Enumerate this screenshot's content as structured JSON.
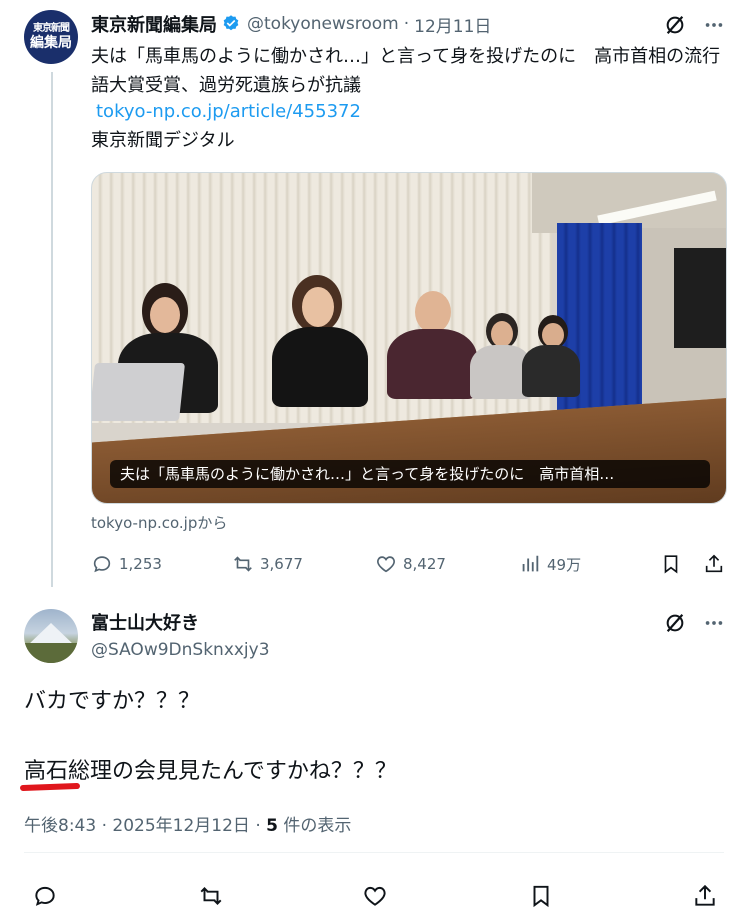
{
  "tweet1": {
    "avatar": {
      "top_text": "東京新聞",
      "bottom_text": "編集局"
    },
    "name": "東京新聞編集局",
    "handle": "@tokyonewsroom",
    "separator": "·",
    "date": "12月11日",
    "text": "夫は「馬車馬のように働かされ…」と言って身を投げたのに　高市首相の流行語大賞受賞、過労死遺族らが抗議",
    "link": "tokyo-np.co.jp/article/455372",
    "source_name": "東京新聞デジタル",
    "image_caption": "夫は「馬車馬のように働かされ…」と言って身を投げたのに　高市首相…",
    "from_site": "tokyo-np.co.jpから",
    "actions": {
      "replies": "1,253",
      "reposts": "3,677",
      "likes": "8,427",
      "views": "49万"
    },
    "icons": [
      "verified-badge-icon",
      "grok-icon",
      "more-icon",
      "reply-icon",
      "repost-icon",
      "like-icon",
      "views-icon",
      "bookmark-icon",
      "share-icon"
    ]
  },
  "tweet2": {
    "name": "富士山大好き",
    "handle": "@SAOw9DnSknxxjy3",
    "line1": "バカですか？？？",
    "line2": "高石総理の会見見たんですかね？？？",
    "timestamp": "午後8:43 · 2025年12月12日 · ",
    "view_count": "5",
    "view_suffix": " 件の表示",
    "icons": [
      "grok-icon",
      "more-icon",
      "reply-icon",
      "repost-icon",
      "like-icon",
      "bookmark-icon",
      "share-icon"
    ]
  },
  "colors": {
    "text_primary": "#0f1419",
    "text_secondary": "#536471",
    "link": "#1d9bf0",
    "verified": "#1d9bf0",
    "annotation_red": "#e0161c"
  }
}
